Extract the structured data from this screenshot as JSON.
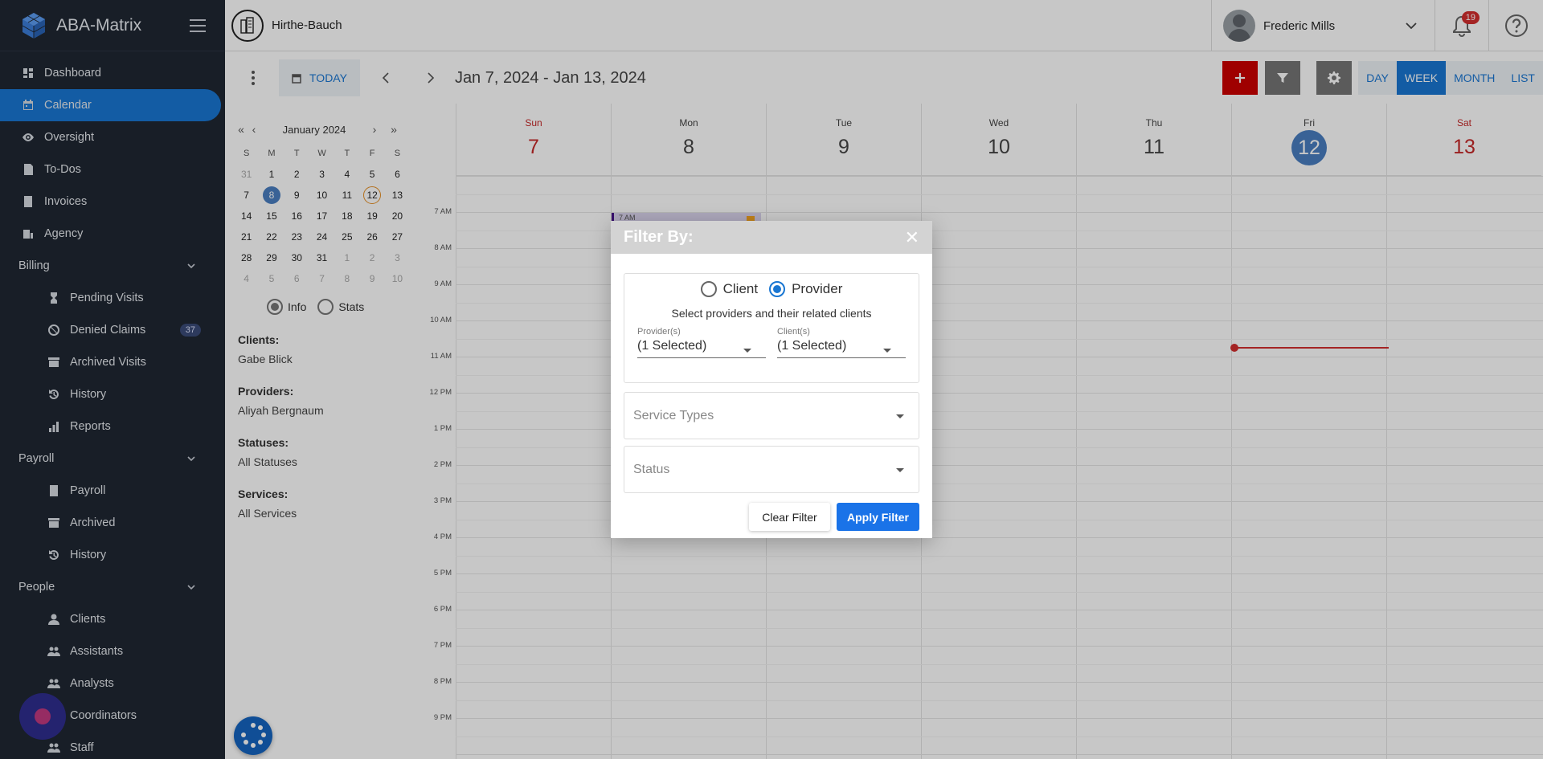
{
  "app": {
    "name": "ABA-Matrix"
  },
  "org": {
    "name": "Hirthe-Bauch"
  },
  "user": {
    "name": "Frederic Mills",
    "notifications": "19"
  },
  "sidebar": {
    "items": [
      {
        "label": "Dashboard"
      },
      {
        "label": "Calendar"
      },
      {
        "label": "Oversight"
      },
      {
        "label": "To-Dos"
      },
      {
        "label": "Invoices"
      },
      {
        "label": "Agency"
      }
    ],
    "billing": {
      "label": "Billing",
      "items": [
        {
          "label": "Pending Visits"
        },
        {
          "label": "Denied Claims",
          "badge": "37"
        },
        {
          "label": "Archived Visits"
        },
        {
          "label": "History"
        },
        {
          "label": "Reports"
        }
      ]
    },
    "payroll": {
      "label": "Payroll",
      "items": [
        {
          "label": "Payroll"
        },
        {
          "label": "Archived"
        },
        {
          "label": "History"
        }
      ]
    },
    "people": {
      "label": "People",
      "items": [
        {
          "label": "Clients"
        },
        {
          "label": "Assistants"
        },
        {
          "label": "Analysts"
        },
        {
          "label": "Coordinators"
        },
        {
          "label": "Staff"
        }
      ]
    }
  },
  "toolbar": {
    "today_label": "TODAY",
    "range": "Jan 7, 2024 - Jan 13, 2024",
    "colors": {
      "add": "#cc0000",
      "filter": "#757575",
      "settings": "#757575"
    },
    "views": [
      "DAY",
      "WEEK",
      "MONTH",
      "LIST"
    ],
    "active_view": "WEEK"
  },
  "mini_calendar": {
    "month_label": "January 2024",
    "weekdays": [
      "S",
      "M",
      "T",
      "W",
      "T",
      "F",
      "S"
    ],
    "weeks": [
      [
        "31",
        "1",
        "2",
        "3",
        "4",
        "5",
        "6"
      ],
      [
        "7",
        "8",
        "9",
        "10",
        "11",
        "12",
        "13"
      ],
      [
        "14",
        "15",
        "16",
        "17",
        "18",
        "19",
        "20"
      ],
      [
        "21",
        "22",
        "23",
        "24",
        "25",
        "26",
        "27"
      ],
      [
        "28",
        "29",
        "30",
        "31",
        "1",
        "2",
        "3"
      ],
      [
        "4",
        "5",
        "6",
        "7",
        "8",
        "9",
        "10"
      ]
    ],
    "selected": "8",
    "today": "12",
    "mode_options": [
      "Info",
      "Stats"
    ],
    "mode_selected": "Info"
  },
  "summary": {
    "clients_label": "Clients:",
    "clients_value": "Gabe Blick",
    "providers_label": "Providers:",
    "providers_value": "Aliyah Bergnaum",
    "statuses_label": "Statuses:",
    "statuses_value": "All Statuses",
    "services_label": "Services:",
    "services_value": "All Services"
  },
  "week": {
    "days": [
      {
        "name": "Sun",
        "num": "7"
      },
      {
        "name": "Mon",
        "num": "8"
      },
      {
        "name": "Tue",
        "num": "9"
      },
      {
        "name": "Wed",
        "num": "10"
      },
      {
        "name": "Thu",
        "num": "11"
      },
      {
        "name": "Fri",
        "num": "12"
      },
      {
        "name": "Sat",
        "num": "13"
      }
    ],
    "current_day": "Fri",
    "times": [
      "7 AM",
      "8 AM",
      "9 AM",
      "10 AM",
      "11 AM",
      "12 PM",
      "1 PM",
      "2 PM",
      "3 PM",
      "4 PM",
      "5 PM",
      "6 PM",
      "7 PM",
      "8 PM",
      "9 PM"
    ],
    "event_label": "7 AM"
  },
  "filter_modal": {
    "title": "Filter By:",
    "type_options": [
      "Client",
      "Provider"
    ],
    "type_selected": "Provider",
    "hint": "Select providers and their related clients",
    "providers_label": "Provider(s)",
    "providers_value": "(1 Selected)",
    "clients_label": "Client(s)",
    "clients_value": "(1 Selected)",
    "service_types_placeholder": "Service Types",
    "status_placeholder": "Status",
    "clear_label": "Clear Filter",
    "apply_label": "Apply Filter"
  }
}
